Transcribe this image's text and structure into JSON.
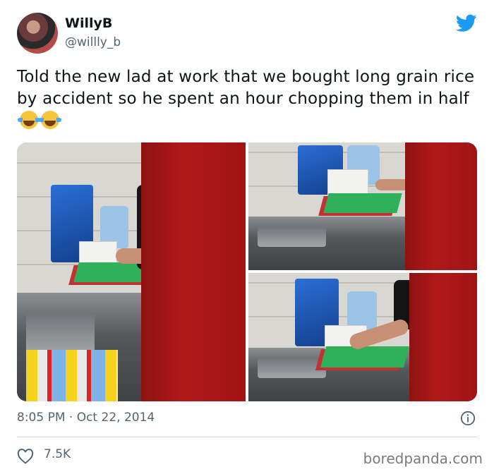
{
  "user": {
    "display_name": "WillyB",
    "handle": "@willly_b"
  },
  "tweet": {
    "text": "Told the new lad at work that we bought long grain rice by accident so he spent an hour chopping them in half",
    "emoji": [
      "face-with-tears-of-joy",
      "face-with-tears-of-joy"
    ]
  },
  "meta": {
    "time": "8:05 PM · Oct 22, 2014",
    "likes": "7.5K"
  },
  "watermark": "boredpanda.com",
  "colors": {
    "twitter_blue": "#1d9bf0",
    "secondary_text": "#536471"
  },
  "icons": [
    "twitter-bird-icon",
    "info-icon",
    "heart-icon"
  ]
}
